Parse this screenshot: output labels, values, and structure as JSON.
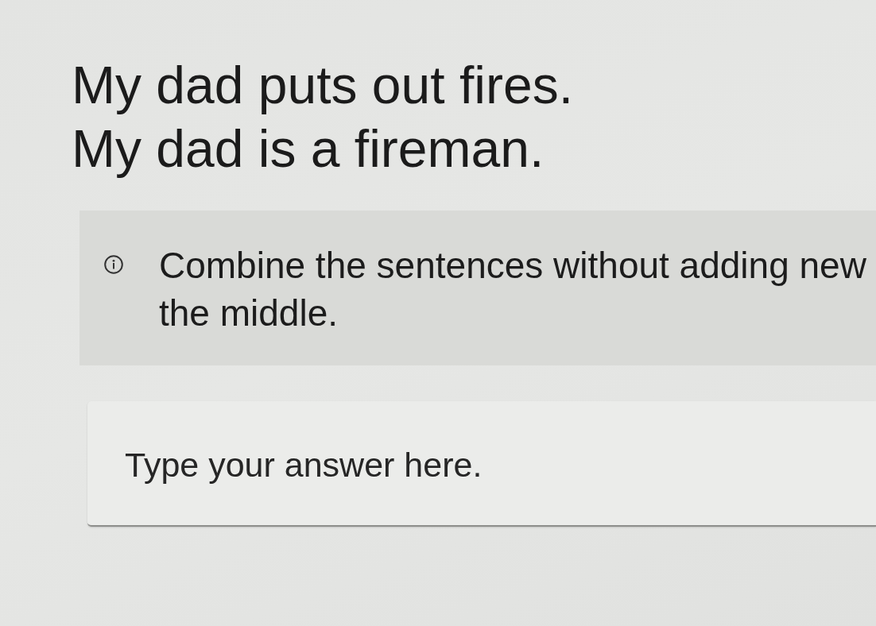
{
  "sentences": [
    "My dad puts out fires.",
    "My dad is a fireman."
  ],
  "hint": {
    "lines": [
      "Combine the sentences without adding new",
      "the middle."
    ]
  },
  "answer": {
    "placeholder": "Type your answer here."
  }
}
